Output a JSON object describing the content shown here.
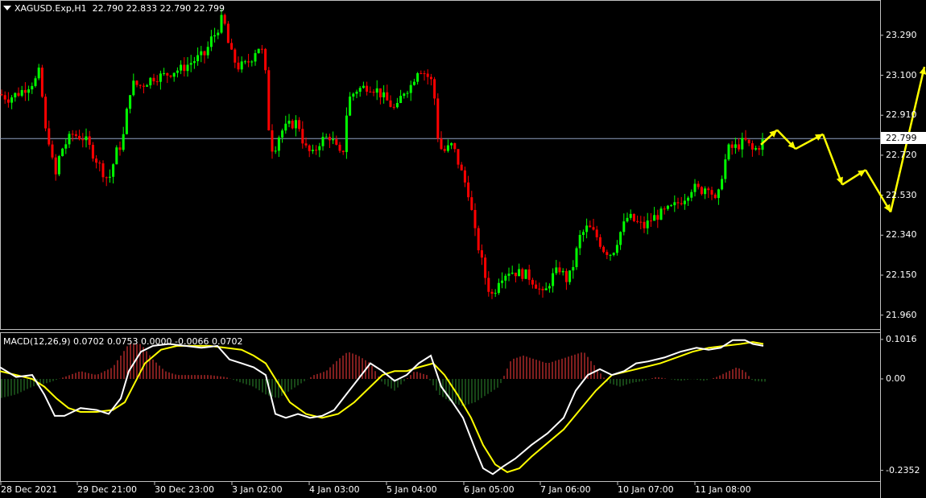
{
  "header": {
    "symbol": "XAGUSD.Exp,H1",
    "ohlc": "22.790 22.833 22.790 22.799"
  },
  "indicator": {
    "label": "MACD(12,26,9) 0.0702 0.0753 0.0000 -0.0066 0.0702"
  },
  "colors": {
    "bull": "#00ff00",
    "bear": "#ff0000",
    "hist_pos": "#ff3b3b",
    "hist_neg": "#2e8b2e",
    "macd_line": "#ffffff",
    "signal_line": "#ffff00",
    "arrow": "#ffff00",
    "grid": "#c0c0c0",
    "current_price_line": "#8fa0c0"
  },
  "chart_data": {
    "type": "candlestick",
    "price_axis": {
      "ticks": [
        "23.290",
        "23.100",
        "22.910",
        "22.720",
        "22.530",
        "22.340",
        "22.150",
        "21.960"
      ],
      "current_price": "22.799",
      "range": [
        21.89,
        23.45
      ]
    },
    "time_axis": {
      "labels": [
        "28 Dec 2021",
        "29 Dec 21:00",
        "30 Dec 23:00",
        "3 Jan 02:00",
        "4 Jan 03:00",
        "5 Jan 04:00",
        "6 Jan 05:00",
        "7 Jan 06:00",
        "10 Jan 07:00",
        "11 Jan 08:00"
      ]
    },
    "price_path": [
      [
        0,
        23.01
      ],
      [
        10,
        22.99
      ],
      [
        25,
        23.02
      ],
      [
        45,
        23.08
      ],
      [
        50,
        23.13
      ],
      [
        55,
        22.85
      ],
      [
        62,
        22.78
      ],
      [
        68,
        22.6
      ],
      [
        75,
        22.74
      ],
      [
        90,
        22.82
      ],
      [
        105,
        22.8
      ],
      [
        118,
        22.71
      ],
      [
        128,
        22.64
      ],
      [
        135,
        22.6
      ],
      [
        145,
        22.74
      ],
      [
        152,
        22.78
      ],
      [
        158,
        22.94
      ],
      [
        163,
        23.06
      ],
      [
        175,
        23.05
      ],
      [
        190,
        23.09
      ],
      [
        205,
        23.1
      ],
      [
        215,
        23.12
      ],
      [
        225,
        23.13
      ],
      [
        245,
        23.18
      ],
      [
        255,
        23.2
      ],
      [
        262,
        23.27
      ],
      [
        268,
        23.3
      ],
      [
        277,
        23.38
      ],
      [
        285,
        23.22
      ],
      [
        295,
        23.14
      ],
      [
        305,
        23.15
      ],
      [
        312,
        23.18
      ],
      [
        320,
        23.24
      ],
      [
        328,
        23.2
      ],
      [
        335,
        22.78
      ],
      [
        340,
        22.74
      ],
      [
        348,
        22.83
      ],
      [
        358,
        22.86
      ],
      [
        370,
        22.88
      ],
      [
        378,
        22.76
      ],
      [
        388,
        22.72
      ],
      [
        398,
        22.79
      ],
      [
        410,
        22.81
      ],
      [
        418,
        22.75
      ],
      [
        425,
        22.7
      ],
      [
        432,
        22.98
      ],
      [
        442,
        23.03
      ],
      [
        458,
        23.05
      ],
      [
        468,
        23.03
      ],
      [
        480,
        22.98
      ],
      [
        492,
        22.93
      ],
      [
        500,
        23.02
      ],
      [
        510,
        23.05
      ],
      [
        520,
        23.14
      ],
      [
        530,
        23.1
      ],
      [
        538,
        23.06
      ],
      [
        545,
        22.76
      ],
      [
        552,
        22.74
      ],
      [
        562,
        22.77
      ],
      [
        572,
        22.65
      ],
      [
        582,
        22.54
      ],
      [
        590,
        22.35
      ],
      [
        598,
        22.22
      ],
      [
        605,
        22.1
      ],
      [
        612,
        22.05
      ],
      [
        620,
        22.14
      ],
      [
        632,
        22.17
      ],
      [
        645,
        22.16
      ],
      [
        655,
        22.15
      ],
      [
        665,
        22.11
      ],
      [
        675,
        22.05
      ],
      [
        685,
        22.14
      ],
      [
        695,
        22.18
      ],
      [
        705,
        22.12
      ],
      [
        712,
        22.2
      ],
      [
        720,
        22.33
      ],
      [
        730,
        22.38
      ],
      [
        740,
        22.34
      ],
      [
        750,
        22.27
      ],
      [
        760,
        22.25
      ],
      [
        770,
        22.35
      ],
      [
        780,
        22.43
      ],
      [
        790,
        22.4
      ],
      [
        800,
        22.38
      ],
      [
        810,
        22.42
      ],
      [
        820,
        22.44
      ],
      [
        835,
        22.47
      ],
      [
        850,
        22.52
      ],
      [
        860,
        22.57
      ],
      [
        870,
        22.55
      ],
      [
        880,
        22.58
      ],
      [
        890,
        22.48
      ],
      [
        898,
        22.66
      ],
      [
        905,
        22.75
      ],
      [
        915,
        22.76
      ],
      [
        925,
        22.79
      ],
      [
        935,
        22.74
      ],
      [
        942,
        22.76
      ],
      [
        950,
        22.8
      ]
    ],
    "forecast_arrows": [
      [
        [
          945,
          22.77
        ],
        [
          965,
          22.84
        ]
      ],
      [
        [
          965,
          22.84
        ],
        [
          988,
          22.75
        ]
      ],
      [
        [
          988,
          22.75
        ],
        [
          1022,
          22.82
        ]
      ],
      [
        [
          1022,
          22.82
        ],
        [
          1046,
          22.58
        ]
      ],
      [
        [
          1046,
          22.58
        ],
        [
          1075,
          22.65
        ]
      ],
      [
        [
          1075,
          22.65
        ],
        [
          1106,
          22.45
        ]
      ],
      [
        [
          1106,
          22.45
        ],
        [
          1148,
          23.14
        ]
      ]
    ],
    "macd": {
      "ticks": [
        "0.1016",
        "0.00",
        "-0.2352"
      ],
      "range": [
        -0.265,
        0.12
      ],
      "histogram": [
        [
          0,
          -0.05
        ],
        [
          20,
          -0.04
        ],
        [
          40,
          -0.02
        ],
        [
          60,
          -0.01
        ],
        [
          80,
          0.005
        ],
        [
          100,
          0.02
        ],
        [
          120,
          0.01
        ],
        [
          140,
          0.03
        ],
        [
          150,
          0.06
        ],
        [
          160,
          0.09
        ],
        [
          175,
          0.09
        ],
        [
          190,
          0.05
        ],
        [
          205,
          0.02
        ],
        [
          220,
          0.01
        ],
        [
          240,
          0.01
        ],
        [
          260,
          0.01
        ],
        [
          280,
          0.005
        ],
        [
          300,
          -0.01
        ],
        [
          315,
          -0.02
        ],
        [
          330,
          -0.04
        ],
        [
          345,
          -0.05
        ],
        [
          360,
          -0.03
        ],
        [
          375,
          -0.01
        ],
        [
          390,
          0.01
        ],
        [
          405,
          0.02
        ],
        [
          420,
          0.05
        ],
        [
          432,
          0.07
        ],
        [
          445,
          0.06
        ],
        [
          460,
          0.04
        ],
        [
          475,
          -0.01
        ],
        [
          490,
          -0.03
        ],
        [
          500,
          -0.01
        ],
        [
          515,
          0.02
        ],
        [
          530,
          0.01
        ],
        [
          545,
          -0.04
        ],
        [
          560,
          -0.06
        ],
        [
          575,
          -0.07
        ],
        [
          590,
          -0.06
        ],
        [
          605,
          -0.04
        ],
        [
          620,
          -0.02
        ],
        [
          635,
          0.05
        ],
        [
          650,
          0.06
        ],
        [
          665,
          0.05
        ],
        [
          680,
          0.04
        ],
        [
          695,
          0.05
        ],
        [
          710,
          0.06
        ],
        [
          725,
          0.07
        ],
        [
          740,
          0.03
        ],
        [
          755,
          -0.01
        ],
        [
          770,
          -0.02
        ],
        [
          785,
          -0.01
        ],
        [
          800,
          -0.005
        ],
        [
          815,
          0.005
        ],
        [
          830,
          0.0
        ],
        [
          845,
          -0.005
        ],
        [
          860,
          0.0
        ],
        [
          875,
          -0.005
        ],
        [
          890,
          0.005
        ],
        [
          905,
          0.02
        ],
        [
          915,
          0.03
        ],
        [
          925,
          0.02
        ],
        [
          935,
          -0.005
        ],
        [
          948,
          -0.007
        ]
      ],
      "macd_line": [
        [
          0,
          0.03
        ],
        [
          20,
          0.005
        ],
        [
          40,
          0.01
        ],
        [
          55,
          -0.04
        ],
        [
          68,
          -0.095
        ],
        [
          80,
          -0.095
        ],
        [
          100,
          -0.075
        ],
        [
          120,
          -0.08
        ],
        [
          135,
          -0.09
        ],
        [
          150,
          -0.05
        ],
        [
          160,
          0.02
        ],
        [
          175,
          0.07
        ],
        [
          190,
          0.085
        ],
        [
          210,
          0.09
        ],
        [
          230,
          0.085
        ],
        [
          250,
          0.08
        ],
        [
          270,
          0.085
        ],
        [
          285,
          0.05
        ],
        [
          300,
          0.04
        ],
        [
          315,
          0.03
        ],
        [
          330,
          0.01
        ],
        [
          342,
          -0.09
        ],
        [
          355,
          -0.1
        ],
        [
          370,
          -0.09
        ],
        [
          385,
          -0.1
        ],
        [
          400,
          -0.095
        ],
        [
          415,
          -0.08
        ],
        [
          430,
          -0.04
        ],
        [
          445,
          0.0
        ],
        [
          460,
          0.04
        ],
        [
          475,
          0.02
        ],
        [
          490,
          -0.005
        ],
        [
          505,
          0.01
        ],
        [
          520,
          0.04
        ],
        [
          535,
          0.06
        ],
        [
          548,
          -0.02
        ],
        [
          562,
          -0.06
        ],
        [
          575,
          -0.1
        ],
        [
          590,
          -0.18
        ],
        [
          600,
          -0.23
        ],
        [
          612,
          -0.245
        ],
        [
          625,
          -0.225
        ],
        [
          640,
          -0.205
        ],
        [
          660,
          -0.17
        ],
        [
          680,
          -0.14
        ],
        [
          700,
          -0.1
        ],
        [
          715,
          -0.03
        ],
        [
          730,
          0.01
        ],
        [
          745,
          0.025
        ],
        [
          760,
          0.01
        ],
        [
          775,
          0.02
        ],
        [
          790,
          0.04
        ],
        [
          805,
          0.045
        ],
        [
          825,
          0.055
        ],
        [
          845,
          0.07
        ],
        [
          865,
          0.08
        ],
        [
          880,
          0.075
        ],
        [
          895,
          0.08
        ],
        [
          910,
          0.1
        ],
        [
          925,
          0.1
        ],
        [
          935,
          0.09
        ],
        [
          948,
          0.085
        ]
      ],
      "signal_line": [
        [
          0,
          0.02
        ],
        [
          20,
          0.01
        ],
        [
          40,
          0.0
        ],
        [
          55,
          -0.02
        ],
        [
          70,
          -0.05
        ],
        [
          85,
          -0.075
        ],
        [
          100,
          -0.085
        ],
        [
          120,
          -0.085
        ],
        [
          140,
          -0.08
        ],
        [
          155,
          -0.06
        ],
        [
          165,
          -0.02
        ],
        [
          180,
          0.04
        ],
        [
          200,
          0.075
        ],
        [
          220,
          0.085
        ],
        [
          240,
          0.085
        ],
        [
          260,
          0.085
        ],
        [
          280,
          0.08
        ],
        [
          300,
          0.075
        ],
        [
          315,
          0.06
        ],
        [
          330,
          0.04
        ],
        [
          345,
          -0.01
        ],
        [
          360,
          -0.06
        ],
        [
          380,
          -0.09
        ],
        [
          400,
          -0.1
        ],
        [
          420,
          -0.09
        ],
        [
          440,
          -0.06
        ],
        [
          460,
          -0.02
        ],
        [
          475,
          0.01
        ],
        [
          490,
          0.02
        ],
        [
          505,
          0.02
        ],
        [
          520,
          0.03
        ],
        [
          538,
          0.04
        ],
        [
          552,
          0.01
        ],
        [
          568,
          -0.04
        ],
        [
          585,
          -0.1
        ],
        [
          600,
          -0.17
        ],
        [
          615,
          -0.22
        ],
        [
          630,
          -0.24
        ],
        [
          645,
          -0.23
        ],
        [
          660,
          -0.2
        ],
        [
          680,
          -0.165
        ],
        [
          700,
          -0.13
        ],
        [
          720,
          -0.08
        ],
        [
          740,
          -0.03
        ],
        [
          760,
          0.01
        ],
        [
          780,
          0.02
        ],
        [
          800,
          0.03
        ],
        [
          820,
          0.04
        ],
        [
          840,
          0.055
        ],
        [
          860,
          0.07
        ],
        [
          880,
          0.08
        ],
        [
          900,
          0.085
        ],
        [
          920,
          0.09
        ],
        [
          935,
          0.095
        ],
        [
          948,
          0.09
        ]
      ]
    }
  }
}
